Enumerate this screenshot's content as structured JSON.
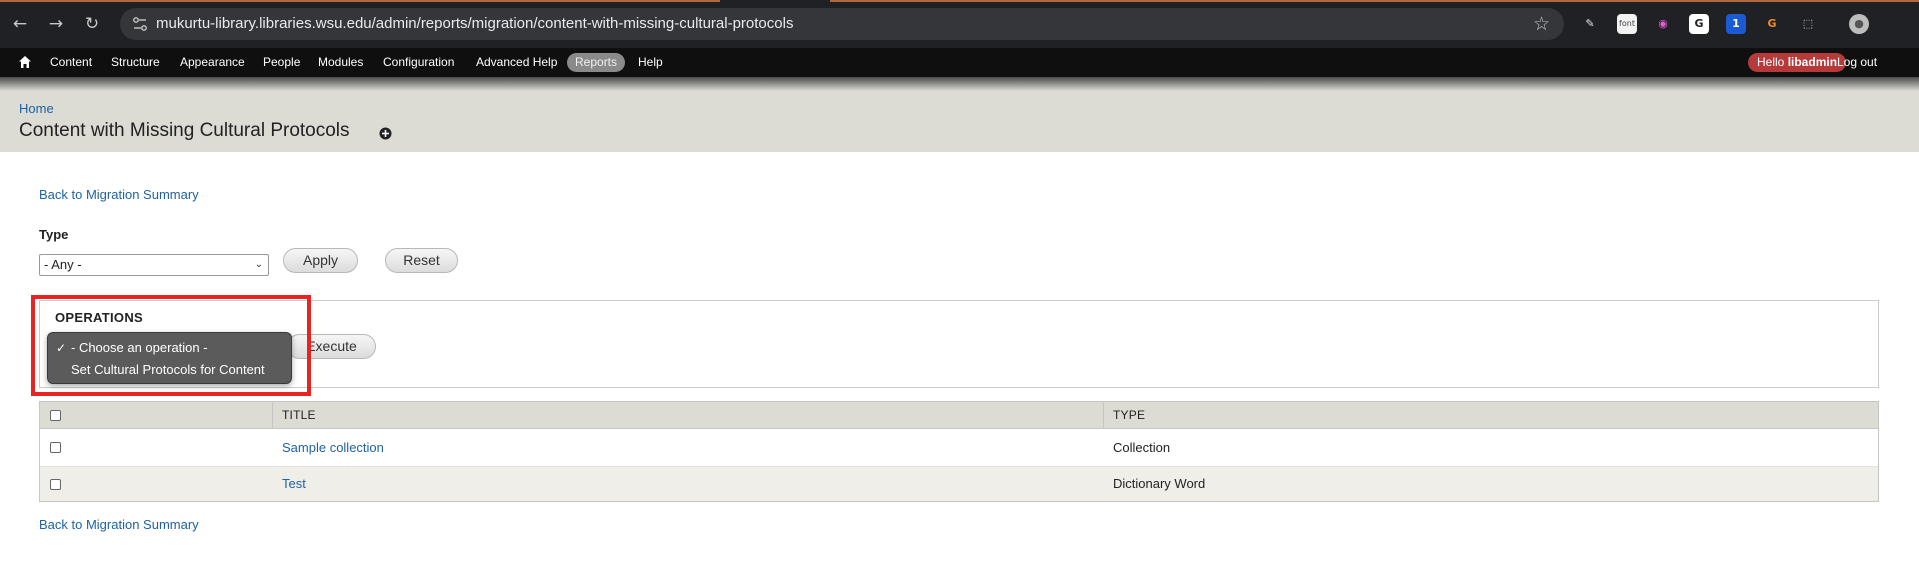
{
  "browser": {
    "url": "mukurtu-library.libraries.wsu.edu/admin/reports/migration/content-with-missing-cultural-protocols",
    "extensions": [
      {
        "name": "eyedropper-icon",
        "glyph": "✎",
        "bg": "#202124",
        "fg": "#e0e0e0"
      },
      {
        "name": "font-extension-icon",
        "glyph": "font",
        "bg": "#f2f2f2",
        "fg": "#444"
      },
      {
        "name": "color-wheel-icon",
        "glyph": "◉",
        "bg": "#202124",
        "fg": "#e55cd6"
      },
      {
        "name": "grammar-extension-icon",
        "glyph": "G",
        "bg": "#ffffff",
        "fg": "#222"
      },
      {
        "name": "password-manager-icon",
        "glyph": "1",
        "bg": "#1a5bd4",
        "fg": "#ffffff"
      },
      {
        "name": "orange-g-extension-icon",
        "glyph": "G",
        "bg": "#202124",
        "fg": "#f08a24"
      },
      {
        "name": "puzzle-icon",
        "glyph": "⬚",
        "bg": "#202124",
        "fg": "#c8c8c8"
      },
      {
        "name": "profile-avatar-icon",
        "glyph": "●",
        "bg": "#bdbdbd",
        "fg": "#555"
      }
    ]
  },
  "toolbar": {
    "items": [
      "Content",
      "Structure",
      "Appearance",
      "People",
      "Modules",
      "Configuration",
      "Advanced Help",
      "Reports",
      "Help"
    ],
    "active": "Reports",
    "hello_prefix": "Hello ",
    "user": "libadmin",
    "logout": "Log out"
  },
  "header": {
    "breadcrumb": "Home",
    "title": "Content with Missing Cultural Protocols"
  },
  "content": {
    "back_link": "Back to Migration Summary",
    "filter": {
      "label": "Type",
      "selected": "- Any -",
      "apply": "Apply",
      "reset": "Reset"
    },
    "operations": {
      "legend": "OPERATIONS",
      "execute": "Execute",
      "options": [
        "- Choose an operation -",
        "Set Cultural Protocols for Content"
      ],
      "checked": "✓"
    },
    "table": {
      "headers": [
        "TITLE",
        "TYPE"
      ],
      "rows": [
        {
          "title": "Sample collection",
          "type": "Collection"
        },
        {
          "title": "Test",
          "type": "Dictionary Word"
        }
      ]
    }
  },
  "colors": {
    "link": "#1d62a5",
    "highlight": "#ea2222",
    "header_bg": "#dcdbd4",
    "hello_badge": "#b63a3a"
  }
}
